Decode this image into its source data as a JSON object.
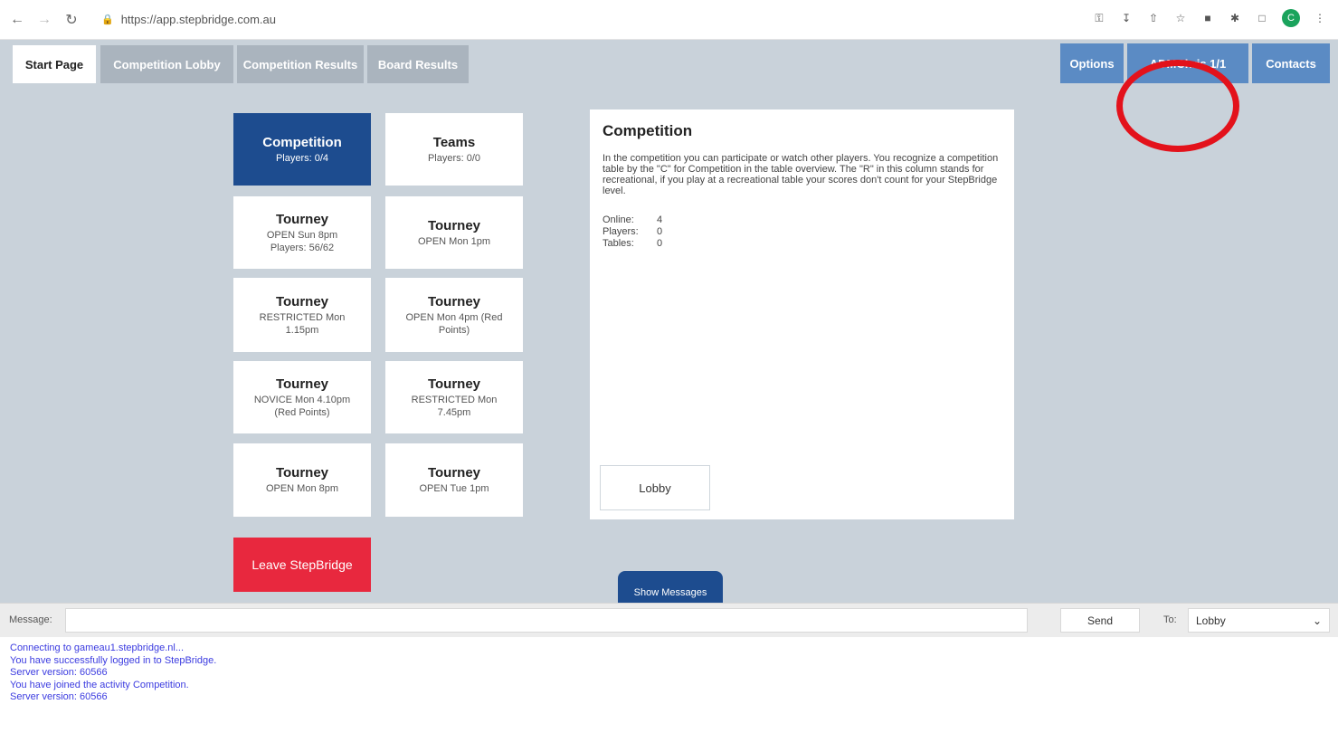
{
  "browser": {
    "url": "https://app.stepbridge.com.au",
    "avatar_letter": "C"
  },
  "tabs": {
    "start_page": "Start Page",
    "competition_lobby": "Competition Lobby",
    "competition_results": "Competition Results",
    "board_results": "Board Results",
    "options": "Options",
    "user": "ADMChris 1/1",
    "contacts": "Contacts"
  },
  "tiles": [
    {
      "title": "Competition",
      "sub": "Players: 0/4"
    },
    {
      "title": "Teams",
      "sub": "Players: 0/0"
    },
    {
      "title": "Tourney",
      "sub": "OPEN Sun 8pm",
      "sub2": "Players: 56/62"
    },
    {
      "title": "Tourney",
      "sub": "OPEN Mon 1pm"
    },
    {
      "title": "Tourney",
      "sub": "RESTRICTED Mon 1.15pm"
    },
    {
      "title": "Tourney",
      "sub": "OPEN Mon 4pm (Red Points)"
    },
    {
      "title": "Tourney",
      "sub": "NOVICE Mon 4.10pm (Red Points)"
    },
    {
      "title": "Tourney",
      "sub": "RESTRICTED Mon 7.45pm"
    },
    {
      "title": "Tourney",
      "sub": "OPEN Mon 8pm"
    },
    {
      "title": "Tourney",
      "sub": "OPEN Tue 1pm"
    }
  ],
  "leave_label": "Leave StepBridge",
  "detail": {
    "title": "Competition",
    "description": "In the competition you can participate or watch other players. You recognize a competition table by the \"C\" for Competition in the table overview. The \"R\" in this column stands for recreational, if you play at a recreational table your scores don't count for your StepBridge level.",
    "stats": [
      {
        "label": "Online:",
        "value": "4"
      },
      {
        "label": "Players:",
        "value": "0"
      },
      {
        "label": "Tables:",
        "value": "0"
      }
    ],
    "lobby_button": "Lobby"
  },
  "show_messages": "Show Messages",
  "message_bar": {
    "label": "Message:",
    "input_value": "",
    "send": "Send",
    "to_label": "To:",
    "to_selected": "Lobby"
  },
  "log": [
    "Connecting to gameau1.stepbridge.nl...",
    "You have successfully logged in to StepBridge.",
    "Server version: 60566",
    "You have joined the activity Competition.",
    "Server version: 60566"
  ],
  "colors": {
    "primary": "#1d4c8f",
    "leave": "#e8283e",
    "highlight": "#e3121b",
    "tab_blue": "#5b8bc4",
    "background": "#c9d2da"
  }
}
